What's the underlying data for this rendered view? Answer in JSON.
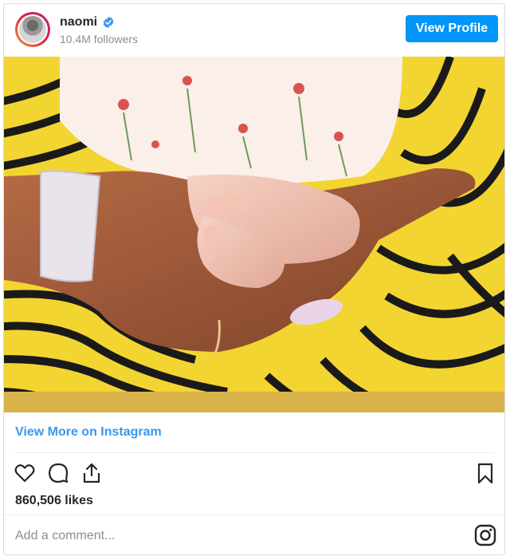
{
  "post": {
    "username": "naomi",
    "followers": "10.4M followers",
    "view_profile_label": "View Profile",
    "view_more_label": "View More on Instagram",
    "likes": "860,506 likes",
    "comment_placeholder": "Add a comment...",
    "image_alt": "Hand cradling newborn baby feet"
  },
  "icons": {
    "verified": "verified-badge-icon",
    "like": "heart-icon",
    "comment": "comment-bubble-icon",
    "share": "share-icon",
    "save": "bookmark-icon",
    "instagram": "instagram-logo-icon"
  },
  "colors": {
    "accent": "#0095f6",
    "link": "#3897f0",
    "muted": "#8e8e8e",
    "text": "#262626"
  }
}
